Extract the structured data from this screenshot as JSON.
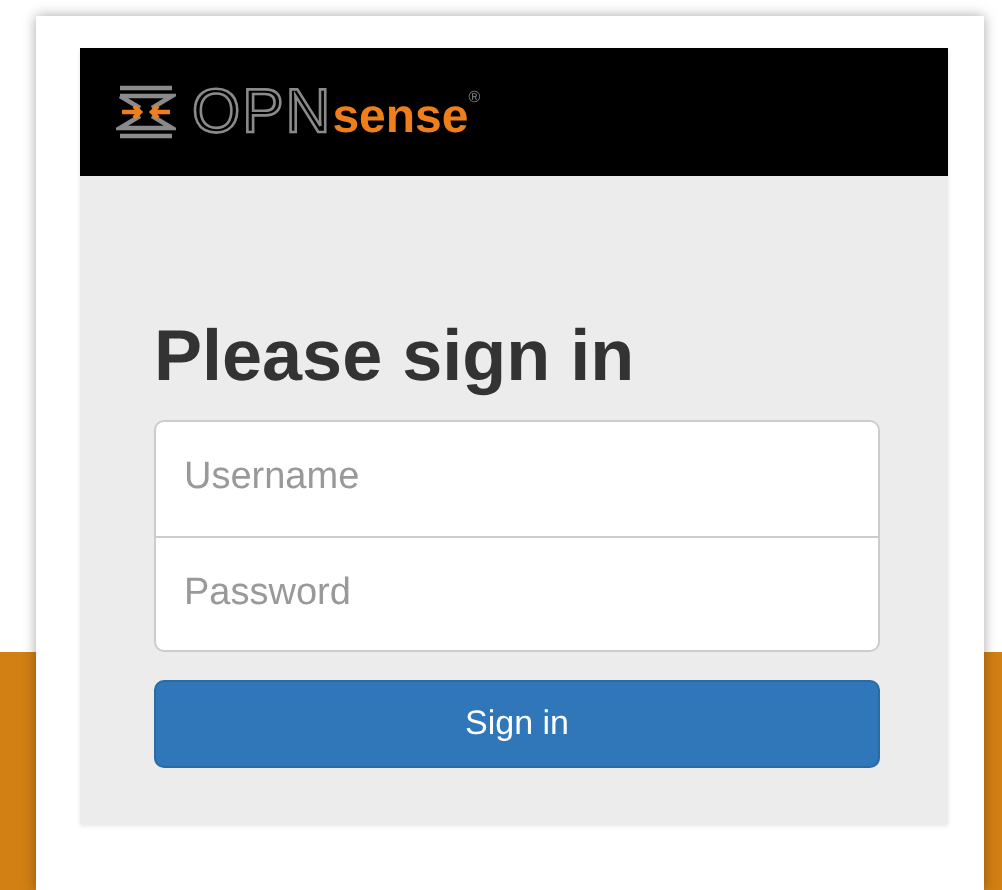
{
  "logo": {
    "prefix": "OPN",
    "suffix": "sense",
    "mark": "®"
  },
  "title": "Please sign in",
  "fields": [
    {
      "placeholder": "Username"
    },
    {
      "placeholder": "Password"
    }
  ],
  "button": "Sign in"
}
